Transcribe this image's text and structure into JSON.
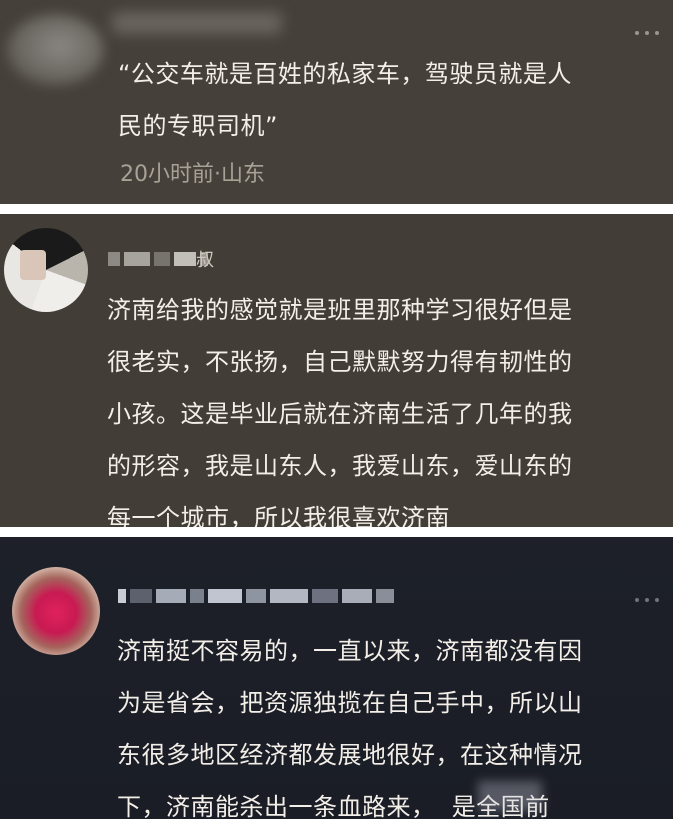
{
  "comments": [
    {
      "text_line1": "“公交车就是百姓的私家车，驾驶员就是人",
      "text_line2": "民的专职司机”",
      "meta": "20小时前·山东",
      "more_icon": "more-dots-icon"
    },
    {
      "name_visible_char": "叔",
      "text": "济南给我的感觉就是班里那种学习很好但是\n很老实，不张扬，自己默默努力得有韧性的\n小孩。这是毕业后就在济南生活了几年的我\n的形容，我是山东人，我爱山东，爱山东的\n每一个城市，所以我很喜欢济南"
    },
    {
      "text": "济南挺不容易的，一直以来，济南都没有因\n为是省会，把资源独揽在自己手中，所以山\n东很多地区经济都发展地很好，在这种情况\n下，济南能杀出一条血路来，  是全国前",
      "more_icon": "more-dots-icon"
    }
  ],
  "colors": {
    "card_brown": "#454039",
    "card_dark": "#1d2029",
    "text": "#f3efe8",
    "meta": "#a8a196"
  }
}
